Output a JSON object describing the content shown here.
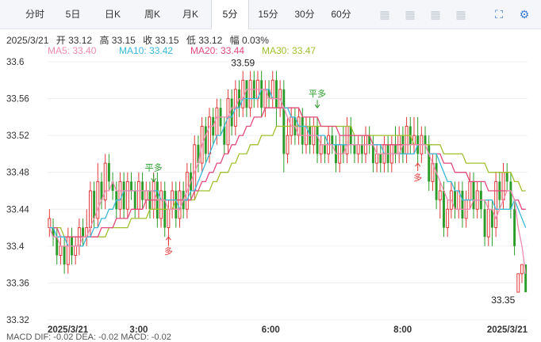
{
  "tabs": [
    {
      "label": "分时"
    },
    {
      "label": "5日"
    },
    {
      "label": "日K"
    },
    {
      "label": "周K"
    },
    {
      "label": "月K"
    },
    {
      "label": "5分"
    },
    {
      "label": "15分"
    },
    {
      "label": "30分"
    },
    {
      "label": "60分"
    }
  ],
  "active_tab": "5分",
  "toolbar_icons": [
    "blurred-icon",
    "blurred-icon",
    "blurred-icon",
    "blurred-icon",
    "fullscreen-icon",
    "settings-icon"
  ],
  "info": {
    "date": "2025/3/21",
    "open": "开 33.12",
    "high": "高 33.15",
    "close": "收 33.15",
    "low": "低 33.12",
    "change": "幅 0.03%"
  },
  "ma_labels": {
    "ma5": "MA5: 33.40",
    "ma10": "MA10: 33.42",
    "ma20": "MA20: 33.44",
    "ma30": "MA30: 33.47"
  },
  "colors": {
    "up": "#e03a3a",
    "down": "#2a9c2a",
    "ma5": "#f08cb0",
    "ma10": "#3cb8d8",
    "ma20": "#e24a7a",
    "ma30": "#a0c030",
    "signal_buy": "#e03a3a",
    "signal_flat": "#2a9c2a"
  },
  "bottom_cut_text": "MACD   DIF: -0.02     DEA: -0.02     MACD: -0.02",
  "chart_data": {
    "type": "candlestick",
    "title": "",
    "ylim": [
      33.32,
      33.6
    ],
    "y_ticks": [
      "33.6",
      "33.56",
      "33.52",
      "33.48",
      "33.44",
      "33.4",
      "33.36",
      "33.32"
    ],
    "x_ticks": [
      "2025/3/21",
      "3:00",
      "6:00",
      "8:00",
      "2025/3/21"
    ],
    "high_label": "33.59",
    "low_label": "33.35",
    "annotations": [
      {
        "text": "平多",
        "type": "flat",
        "candle": 28,
        "price": 33.47
      },
      {
        "text": "平多",
        "type": "flat",
        "candle": 72,
        "price": 33.55
      },
      {
        "text": "多",
        "type": "buy",
        "candle": 32,
        "price": 33.41
      },
      {
        "text": "多",
        "type": "buy",
        "candle": 99,
        "price": 33.49
      }
    ],
    "candles": [
      [
        33.42,
        33.43,
        33.41,
        33.44
      ],
      [
        33.42,
        33.41,
        33.4,
        33.43
      ],
      [
        33.41,
        33.39,
        33.38,
        33.42
      ],
      [
        33.39,
        33.4,
        33.38,
        33.41
      ],
      [
        33.4,
        33.38,
        33.37,
        33.41
      ],
      [
        33.38,
        33.41,
        33.37,
        33.42
      ],
      [
        33.41,
        33.39,
        33.38,
        33.42
      ],
      [
        33.39,
        33.4,
        33.38,
        33.41
      ],
      [
        33.4,
        33.42,
        33.39,
        33.43
      ],
      [
        33.42,
        33.41,
        33.4,
        33.43
      ],
      [
        33.41,
        33.42,
        33.4,
        33.44
      ],
      [
        33.42,
        33.46,
        33.41,
        33.47
      ],
      [
        33.46,
        33.43,
        33.42,
        33.47
      ],
      [
        33.43,
        33.47,
        33.42,
        33.49
      ],
      [
        33.47,
        33.45,
        33.44,
        33.48
      ],
      [
        33.45,
        33.49,
        33.44,
        33.5
      ],
      [
        33.49,
        33.47,
        33.46,
        33.5
      ],
      [
        33.47,
        33.46,
        33.45,
        33.48
      ],
      [
        33.46,
        33.44,
        33.43,
        33.47
      ],
      [
        33.44,
        33.47,
        33.43,
        33.48
      ],
      [
        33.47,
        33.44,
        33.43,
        33.48
      ],
      [
        33.44,
        33.47,
        33.43,
        33.48
      ],
      [
        33.47,
        33.46,
        33.45,
        33.48
      ],
      [
        33.46,
        33.44,
        33.43,
        33.47
      ],
      [
        33.44,
        33.47,
        33.43,
        33.48
      ],
      [
        33.47,
        33.45,
        33.44,
        33.48
      ],
      [
        33.45,
        33.46,
        33.44,
        33.47
      ],
      [
        33.46,
        33.44,
        33.43,
        33.47
      ],
      [
        33.44,
        33.47,
        33.43,
        33.48
      ],
      [
        33.47,
        33.43,
        33.42,
        33.48
      ],
      [
        33.43,
        33.46,
        33.42,
        33.47
      ],
      [
        33.46,
        33.42,
        33.41,
        33.47
      ],
      [
        33.42,
        33.44,
        33.4,
        33.45
      ],
      [
        33.44,
        33.46,
        33.43,
        33.47
      ],
      [
        33.46,
        33.43,
        33.42,
        33.47
      ],
      [
        33.43,
        33.46,
        33.42,
        33.47
      ],
      [
        33.46,
        33.44,
        33.43,
        33.47
      ],
      [
        33.44,
        33.48,
        33.43,
        33.49
      ],
      [
        33.48,
        33.46,
        33.45,
        33.49
      ],
      [
        33.46,
        33.51,
        33.45,
        33.52
      ],
      [
        33.51,
        33.49,
        33.48,
        33.52
      ],
      [
        33.49,
        33.53,
        33.48,
        33.54
      ],
      [
        33.53,
        33.5,
        33.49,
        33.54
      ],
      [
        33.5,
        33.54,
        33.49,
        33.55
      ],
      [
        33.54,
        33.52,
        33.51,
        33.55
      ],
      [
        33.52,
        33.55,
        33.51,
        33.56
      ],
      [
        33.55,
        33.53,
        33.52,
        33.56
      ],
      [
        33.53,
        33.51,
        33.5,
        33.54
      ],
      [
        33.51,
        33.56,
        33.5,
        33.57
      ],
      [
        33.56,
        33.53,
        33.52,
        33.57
      ],
      [
        33.53,
        33.57,
        33.52,
        33.58
      ],
      [
        33.57,
        33.55,
        33.54,
        33.58
      ],
      [
        33.55,
        33.58,
        33.54,
        33.59
      ],
      [
        33.58,
        33.55,
        33.54,
        33.58
      ],
      [
        33.55,
        33.58,
        33.54,
        33.59
      ],
      [
        33.58,
        33.56,
        33.55,
        33.59
      ],
      [
        33.56,
        33.58,
        33.55,
        33.59
      ],
      [
        33.58,
        33.55,
        33.54,
        33.59
      ],
      [
        33.55,
        33.57,
        33.54,
        33.58
      ],
      [
        33.57,
        33.56,
        33.55,
        33.58
      ],
      [
        33.56,
        33.58,
        33.55,
        33.59
      ],
      [
        33.58,
        33.55,
        33.53,
        33.59
      ],
      [
        33.55,
        33.57,
        33.54,
        33.58
      ],
      [
        33.57,
        33.5,
        33.48,
        33.58
      ],
      [
        33.5,
        33.52,
        33.49,
        33.54
      ],
      [
        33.52,
        33.54,
        33.51,
        33.55
      ],
      [
        33.54,
        33.52,
        33.51,
        33.55
      ],
      [
        33.52,
        33.54,
        33.51,
        33.55
      ],
      [
        33.54,
        33.51,
        33.5,
        33.55
      ],
      [
        33.51,
        33.53,
        33.5,
        33.54
      ],
      [
        33.53,
        33.51,
        33.5,
        33.54
      ],
      [
        33.51,
        33.53,
        33.5,
        33.54
      ],
      [
        33.53,
        33.5,
        33.49,
        33.54
      ],
      [
        33.5,
        33.51,
        33.49,
        33.52
      ],
      [
        33.51,
        33.5,
        33.49,
        33.52
      ],
      [
        33.5,
        33.52,
        33.49,
        33.53
      ],
      [
        33.52,
        33.51,
        33.5,
        33.53
      ],
      [
        33.51,
        33.49,
        33.48,
        33.52
      ],
      [
        33.49,
        33.51,
        33.48,
        33.52
      ],
      [
        33.51,
        33.5,
        33.49,
        33.53
      ],
      [
        33.5,
        33.53,
        33.49,
        33.54
      ],
      [
        33.53,
        33.51,
        33.5,
        33.54
      ],
      [
        33.51,
        33.5,
        33.49,
        33.52
      ],
      [
        33.5,
        33.51,
        33.49,
        33.52
      ],
      [
        33.51,
        33.5,
        33.49,
        33.52
      ],
      [
        33.5,
        33.52,
        33.49,
        33.53
      ],
      [
        33.52,
        33.51,
        33.5,
        33.53
      ],
      [
        33.51,
        33.49,
        33.48,
        33.52
      ],
      [
        33.49,
        33.5,
        33.48,
        33.51
      ],
      [
        33.5,
        33.49,
        33.48,
        33.51
      ],
      [
        33.49,
        33.51,
        33.48,
        33.52
      ],
      [
        33.51,
        33.49,
        33.48,
        33.52
      ],
      [
        33.49,
        33.51,
        33.48,
        33.52
      ],
      [
        33.51,
        33.5,
        33.49,
        33.53
      ],
      [
        33.5,
        33.52,
        33.49,
        33.53
      ],
      [
        33.52,
        33.5,
        33.49,
        33.53
      ],
      [
        33.5,
        33.53,
        33.49,
        33.54
      ],
      [
        33.53,
        33.51,
        33.5,
        33.54
      ],
      [
        33.51,
        33.52,
        33.5,
        33.54
      ],
      [
        33.52,
        33.5,
        33.49,
        33.54
      ],
      [
        33.5,
        33.52,
        33.49,
        33.53
      ],
      [
        33.52,
        33.51,
        33.5,
        33.53
      ],
      [
        33.51,
        33.47,
        33.46,
        33.52
      ],
      [
        33.47,
        33.49,
        33.46,
        33.5
      ],
      [
        33.49,
        33.45,
        33.44,
        33.5
      ],
      [
        33.45,
        33.46,
        33.43,
        33.47
      ],
      [
        33.46,
        33.42,
        33.41,
        33.47
      ],
      [
        33.42,
        33.44,
        33.41,
        33.45
      ],
      [
        33.44,
        33.46,
        33.43,
        33.47
      ],
      [
        33.46,
        33.44,
        33.43,
        33.47
      ],
      [
        33.44,
        33.46,
        33.43,
        33.47
      ],
      [
        33.46,
        33.43,
        33.42,
        33.47
      ],
      [
        33.43,
        33.45,
        33.42,
        33.46
      ],
      [
        33.45,
        33.47,
        33.44,
        33.48
      ],
      [
        33.47,
        33.44,
        33.43,
        33.48
      ],
      [
        33.44,
        33.46,
        33.43,
        33.47
      ],
      [
        33.46,
        33.44,
        33.43,
        33.47
      ],
      [
        33.44,
        33.41,
        33.4,
        33.45
      ],
      [
        33.41,
        33.44,
        33.4,
        33.45
      ],
      [
        33.44,
        33.42,
        33.4,
        33.45
      ],
      [
        33.42,
        33.47,
        33.41,
        33.48
      ],
      [
        33.47,
        33.45,
        33.44,
        33.48
      ],
      [
        33.45,
        33.48,
        33.44,
        33.49
      ],
      [
        33.48,
        33.47,
        33.46,
        33.49
      ],
      [
        33.47,
        33.44,
        33.43,
        33.48
      ],
      [
        33.44,
        33.4,
        33.39,
        33.45
      ],
      [
        33.35,
        33.37,
        33.35,
        33.37
      ],
      [
        33.37,
        33.38,
        33.36,
        33.38
      ],
      [
        33.38,
        33.35,
        33.35,
        33.38
      ]
    ],
    "ma5": [
      33.42,
      33.41,
      33.41,
      33.4,
      33.4,
      33.4,
      33.4,
      33.4,
      33.4,
      33.41,
      33.41,
      33.42,
      33.43,
      33.44,
      33.45,
      33.46,
      33.46,
      33.47,
      33.46,
      33.46,
      33.46,
      33.46,
      33.46,
      33.46,
      33.46,
      33.46,
      33.46,
      33.46,
      33.46,
      33.45,
      33.45,
      33.45,
      33.44,
      33.44,
      33.44,
      33.44,
      33.45,
      33.46,
      33.47,
      33.48,
      33.49,
      33.51,
      33.52,
      33.53,
      33.53,
      33.54,
      33.54,
      33.54,
      33.54,
      33.55,
      33.55,
      33.56,
      33.56,
      33.57,
      33.57,
      33.57,
      33.57,
      33.57,
      33.57,
      33.56,
      33.56,
      33.56,
      33.56,
      33.55,
      33.54,
      33.53,
      33.53,
      33.52,
      33.52,
      33.52,
      33.52,
      33.52,
      33.52,
      33.51,
      33.51,
      33.51,
      33.51,
      33.5,
      33.5,
      33.5,
      33.51,
      33.51,
      33.51,
      33.51,
      33.51,
      33.51,
      33.51,
      33.51,
      33.5,
      33.5,
      33.5,
      33.5,
      33.5,
      33.5,
      33.5,
      33.51,
      33.51,
      33.51,
      33.51,
      33.51,
      33.51,
      33.51,
      33.5,
      33.49,
      33.48,
      33.47,
      33.46,
      33.45,
      33.45,
      33.44,
      33.44,
      33.44,
      33.44,
      33.44,
      33.45,
      33.45,
      33.45,
      33.45,
      33.44,
      33.44,
      33.43,
      33.44,
      33.45,
      33.46,
      33.46,
      33.45,
      33.42,
      33.4,
      33.37
    ],
    "ma10": [
      33.42,
      33.42,
      33.41,
      33.41,
      33.41,
      33.4,
      33.4,
      33.4,
      33.4,
      33.4,
      33.41,
      33.41,
      33.42,
      33.42,
      33.43,
      33.43,
      33.44,
      33.44,
      33.45,
      33.45,
      33.46,
      33.46,
      33.46,
      33.46,
      33.46,
      33.46,
      33.46,
      33.46,
      33.46,
      33.46,
      33.45,
      33.45,
      33.45,
      33.45,
      33.45,
      33.44,
      33.45,
      33.45,
      33.46,
      33.46,
      33.47,
      33.48,
      33.49,
      33.5,
      33.51,
      33.52,
      33.52,
      33.53,
      33.54,
      33.54,
      33.55,
      33.55,
      33.56,
      33.56,
      33.56,
      33.56,
      33.56,
      33.57,
      33.57,
      33.57,
      33.56,
      33.56,
      33.56,
      33.55,
      33.55,
      33.54,
      33.54,
      33.53,
      33.53,
      33.53,
      33.52,
      33.52,
      33.52,
      33.52,
      33.52,
      33.51,
      33.51,
      33.51,
      33.51,
      33.51,
      33.51,
      33.51,
      33.51,
      33.51,
      33.51,
      33.51,
      33.51,
      33.51,
      33.51,
      33.51,
      33.5,
      33.5,
      33.5,
      33.5,
      33.5,
      33.5,
      33.5,
      33.5,
      33.5,
      33.51,
      33.51,
      33.51,
      33.5,
      33.5,
      33.5,
      33.49,
      33.48,
      33.47,
      33.47,
      33.46,
      33.46,
      33.45,
      33.45,
      33.45,
      33.45,
      33.45,
      33.45,
      33.45,
      33.45,
      33.45,
      33.44,
      33.44,
      33.44,
      33.44,
      33.44,
      33.45,
      33.44,
      33.43,
      33.42
    ],
    "ma20": [
      33.42,
      33.42,
      33.42,
      33.41,
      33.41,
      33.41,
      33.41,
      33.41,
      33.41,
      33.41,
      33.41,
      33.41,
      33.41,
      33.41,
      33.42,
      33.42,
      33.42,
      33.42,
      33.43,
      33.43,
      33.43,
      33.43,
      33.44,
      33.44,
      33.44,
      33.44,
      33.45,
      33.45,
      33.45,
      33.45,
      33.45,
      33.45,
      33.45,
      33.45,
      33.45,
      33.45,
      33.45,
      33.45,
      33.45,
      33.46,
      33.46,
      33.47,
      33.47,
      33.48,
      33.48,
      33.49,
      33.49,
      33.5,
      33.5,
      33.51,
      33.51,
      33.52,
      33.52,
      33.53,
      33.53,
      33.54,
      33.54,
      33.54,
      33.55,
      33.55,
      33.55,
      33.55,
      33.55,
      33.55,
      33.55,
      33.55,
      33.55,
      33.55,
      33.54,
      33.54,
      33.54,
      33.54,
      33.54,
      33.53,
      33.53,
      33.53,
      33.53,
      33.53,
      33.52,
      33.52,
      33.52,
      33.52,
      33.52,
      33.52,
      33.52,
      33.52,
      33.52,
      33.51,
      33.51,
      33.51,
      33.51,
      33.51,
      33.51,
      33.51,
      33.51,
      33.51,
      33.51,
      33.51,
      33.51,
      33.51,
      33.51,
      33.51,
      33.5,
      33.5,
      33.5,
      33.5,
      33.49,
      33.49,
      33.49,
      33.48,
      33.48,
      33.48,
      33.48,
      33.47,
      33.47,
      33.47,
      33.47,
      33.47,
      33.46,
      33.46,
      33.46,
      33.46,
      33.46,
      33.46,
      33.46,
      33.45,
      33.45,
      33.44,
      33.44
    ],
    "ma30": [
      33.42,
      33.42,
      33.42,
      33.42,
      33.41,
      33.41,
      33.41,
      33.41,
      33.41,
      33.41,
      33.41,
      33.41,
      33.41,
      33.41,
      33.41,
      33.41,
      33.42,
      33.42,
      33.42,
      33.42,
      33.42,
      33.42,
      33.43,
      33.43,
      33.43,
      33.43,
      33.43,
      33.44,
      33.44,
      33.44,
      33.44,
      33.44,
      33.44,
      33.44,
      33.45,
      33.45,
      33.45,
      33.45,
      33.45,
      33.45,
      33.46,
      33.46,
      33.46,
      33.46,
      33.47,
      33.47,
      33.48,
      33.48,
      33.48,
      33.49,
      33.49,
      33.5,
      33.5,
      33.5,
      33.51,
      33.51,
      33.51,
      33.52,
      33.52,
      33.52,
      33.52,
      33.53,
      33.53,
      33.53,
      33.53,
      33.53,
      33.53,
      33.53,
      33.53,
      33.53,
      33.53,
      33.53,
      33.53,
      33.53,
      33.53,
      33.53,
      33.53,
      33.53,
      33.53,
      33.53,
      33.53,
      33.53,
      33.52,
      33.52,
      33.52,
      33.52,
      33.52,
      33.52,
      33.52,
      33.52,
      33.52,
      33.52,
      33.52,
      33.52,
      33.52,
      33.52,
      33.52,
      33.52,
      33.51,
      33.51,
      33.51,
      33.51,
      33.51,
      33.51,
      33.51,
      33.51,
      33.5,
      33.5,
      33.5,
      33.5,
      33.5,
      33.5,
      33.49,
      33.49,
      33.49,
      33.49,
      33.49,
      33.49,
      33.48,
      33.48,
      33.48,
      33.48,
      33.48,
      33.48,
      33.48,
      33.47,
      33.47,
      33.46,
      33.46
    ]
  }
}
